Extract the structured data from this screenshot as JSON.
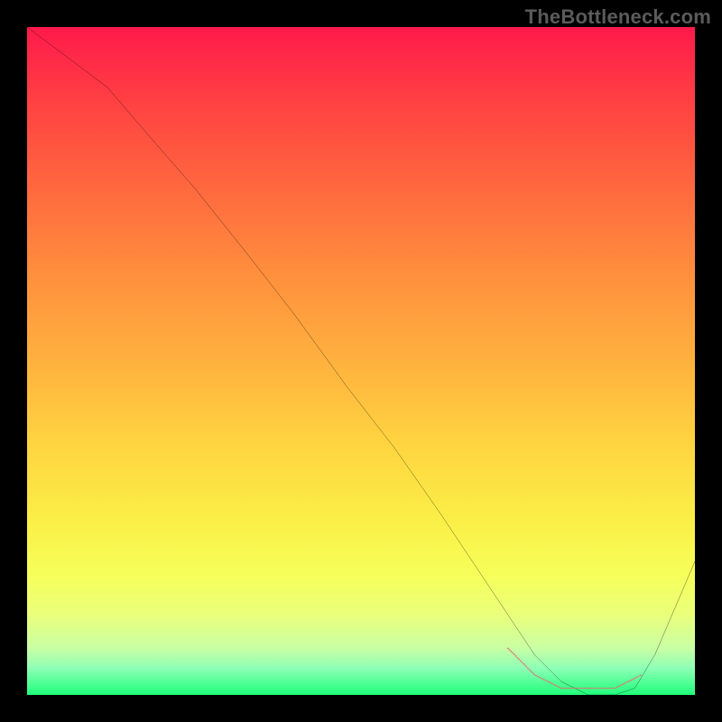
{
  "watermark": "TheBottleneck.com",
  "chart_data": {
    "type": "line",
    "title": "",
    "xlabel": "",
    "ylabel": "",
    "xlim": [
      0,
      100
    ],
    "ylim": [
      0,
      100
    ],
    "grid": false,
    "series": [
      {
        "name": "curve",
        "x": [
          0,
          4,
          8,
          12,
          18,
          25,
          33,
          40,
          48,
          55,
          62,
          68,
          72,
          76,
          80,
          84,
          88,
          91,
          94,
          97,
          100
        ],
        "values": [
          100,
          97,
          94,
          91,
          84,
          76,
          66,
          57,
          46,
          37,
          27,
          18,
          12,
          6,
          2,
          0,
          0,
          1,
          6,
          13,
          20
        ]
      },
      {
        "name": "highlight-segment",
        "x": [
          72,
          74,
          76,
          78,
          80,
          82,
          84,
          86,
          88,
          90,
          92
        ],
        "values": [
          7,
          5,
          3,
          2,
          1,
          1,
          1,
          1,
          1,
          2,
          3
        ]
      }
    ],
    "annotations": []
  },
  "colors": {
    "curve_stroke": "#000000",
    "highlight_stroke": "#e07070",
    "background_border": "#000000"
  }
}
